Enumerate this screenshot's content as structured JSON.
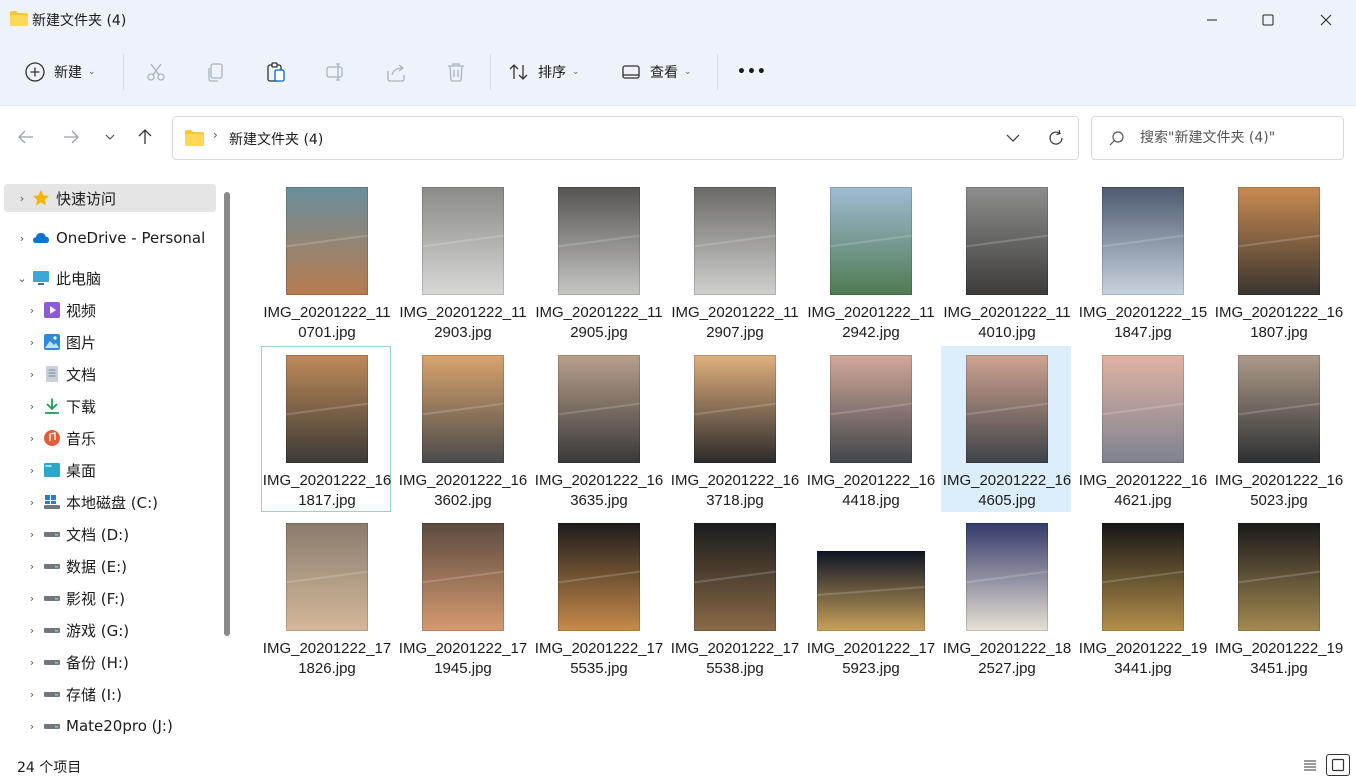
{
  "window": {
    "title": "新建文件夹 (4)"
  },
  "toolbar": {
    "new_label": "新建",
    "sort_label": "排序",
    "view_label": "查看",
    "more_label": "•••"
  },
  "nav": {
    "breadcrumb": "新建文件夹 (4)",
    "search_placeholder": "搜索\"新建文件夹 (4)\""
  },
  "sidebar": {
    "items": [
      {
        "label": "快速访问",
        "icon": "star-icon"
      },
      {
        "label": "OneDrive - Personal",
        "icon": "cloud-icon"
      },
      {
        "label": "此电脑",
        "icon": "monitor-icon"
      },
      {
        "label": "视频",
        "icon": "video-icon"
      },
      {
        "label": "图片",
        "icon": "pictures-icon"
      },
      {
        "label": "文档",
        "icon": "documents-icon"
      },
      {
        "label": "下载",
        "icon": "download-icon"
      },
      {
        "label": "音乐",
        "icon": "music-icon"
      },
      {
        "label": "桌面",
        "icon": "desktop-icon"
      },
      {
        "label": "本地磁盘 (C:)",
        "icon": "system-drive-icon"
      },
      {
        "label": "文档 (D:)",
        "icon": "drive-icon"
      },
      {
        "label": "数据 (E:)",
        "icon": "drive-icon"
      },
      {
        "label": "影视 (F:)",
        "icon": "drive-icon"
      },
      {
        "label": "游戏 (G:)",
        "icon": "drive-icon"
      },
      {
        "label": "备份 (H:)",
        "icon": "drive-icon"
      },
      {
        "label": "存储 (I:)",
        "icon": "drive-icon"
      },
      {
        "label": "Mate20pro (J:)",
        "icon": "drive-icon"
      }
    ]
  },
  "files": [
    {
      "name": "IMG_20201222_110701.jpg",
      "colors": [
        "#6a8f9c",
        "#b87a4e"
      ]
    },
    {
      "name": "IMG_20201222_112903.jpg",
      "colors": [
        "#8a8a86",
        "#d8d8d6"
      ]
    },
    {
      "name": "IMG_20201222_112905.jpg",
      "colors": [
        "#555450",
        "#c6c6c4"
      ]
    },
    {
      "name": "IMG_20201222_112907.jpg",
      "colors": [
        "#6b6a66",
        "#d0d0ce"
      ]
    },
    {
      "name": "IMG_20201222_112942.jpg",
      "colors": [
        "#9fbcd4",
        "#4f7a52"
      ]
    },
    {
      "name": "IMG_20201222_114010.jpg",
      "colors": [
        "#8e8e8e",
        "#3d3c39"
      ]
    },
    {
      "name": "IMG_20201222_151847.jpg",
      "colors": [
        "#4e5a70",
        "#c9d3de"
      ]
    },
    {
      "name": "IMG_20201222_161807.jpg",
      "colors": [
        "#c98a52",
        "#3a3631"
      ]
    },
    {
      "name": "IMG_20201222_161817.jpg",
      "colors": [
        "#c08a5a",
        "#3b3a37"
      ]
    },
    {
      "name": "IMG_20201222_163602.jpg",
      "colors": [
        "#d9a36c",
        "#4a4b4c"
      ]
    },
    {
      "name": "IMG_20201222_163635.jpg",
      "colors": [
        "#b9a08a",
        "#38393a"
      ]
    },
    {
      "name": "IMG_20201222_163718.jpg",
      "colors": [
        "#e1b07e",
        "#2b2b2b"
      ]
    },
    {
      "name": "IMG_20201222_164418.jpg",
      "colors": [
        "#d2a89a",
        "#41464c"
      ]
    },
    {
      "name": "IMG_20201222_164605.jpg",
      "colors": [
        "#cfa391",
        "#3e4347"
      ]
    },
    {
      "name": "IMG_20201222_164621.jpg",
      "colors": [
        "#e0b3a3",
        "#7d8290"
      ]
    },
    {
      "name": "IMG_20201222_165023.jpg",
      "colors": [
        "#ae9b8a",
        "#2e3032"
      ]
    },
    {
      "name": "IMG_20201222_171826.jpg",
      "colors": [
        "#8a7c6c",
        "#d5b99a"
      ]
    },
    {
      "name": "IMG_20201222_171945.jpg",
      "colors": [
        "#5c4b3f",
        "#d69a70"
      ]
    },
    {
      "name": "IMG_20201222_175535.jpg",
      "colors": [
        "#1e1c1b",
        "#c88b4a"
      ]
    },
    {
      "name": "IMG_20201222_175538.jpg",
      "colors": [
        "#1b1b1d",
        "#8a6a46"
      ]
    },
    {
      "name": "IMG_20201222_175923.jpg",
      "colors": [
        "#0e1424",
        "#c9a25a"
      ]
    },
    {
      "name": "IMG_20201222_182527.jpg",
      "colors": [
        "#343a6a",
        "#e8e0d4"
      ]
    },
    {
      "name": "IMG_20201222_193441.jpg",
      "colors": [
        "#161616",
        "#b58f4a"
      ]
    },
    {
      "name": "IMG_20201222_193451.jpg",
      "colors": [
        "#1a1a1a",
        "#a48a52"
      ]
    }
  ],
  "status": {
    "item_count": "24 个项目"
  },
  "colors": {
    "folder_yellow": "#f8c53a",
    "accent": "#0067c0",
    "selected_tile": "#dceefb",
    "focus_border": "#99d1db"
  }
}
